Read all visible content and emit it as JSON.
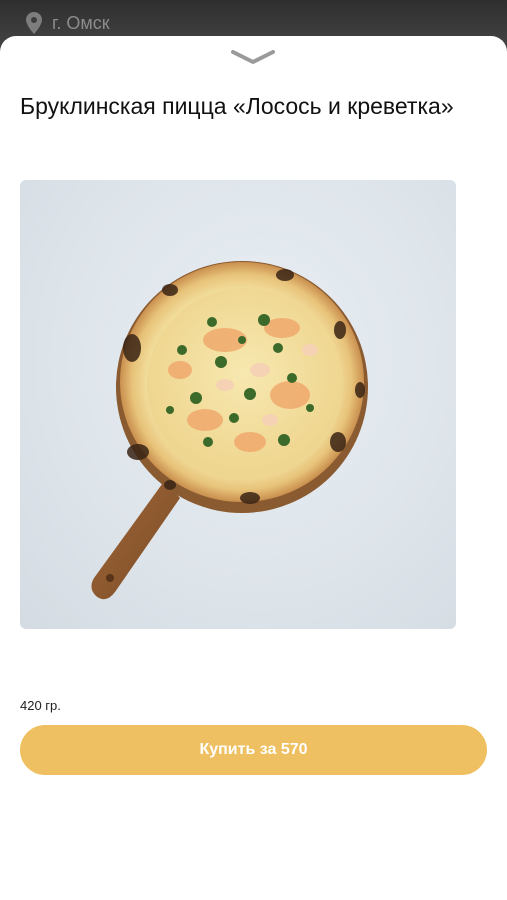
{
  "location": {
    "city": "г. Омск",
    "icon": "location-pin-icon"
  },
  "product": {
    "title": "Бруклинская пицца «Лосось и креветка»",
    "weight": "420 гр.",
    "image_alt": "pizza"
  },
  "actions": {
    "buy_label": "Купить за 570"
  },
  "colors": {
    "accent": "#efc061",
    "sheet": "#ffffff",
    "backdrop": "#3a3a3a"
  }
}
